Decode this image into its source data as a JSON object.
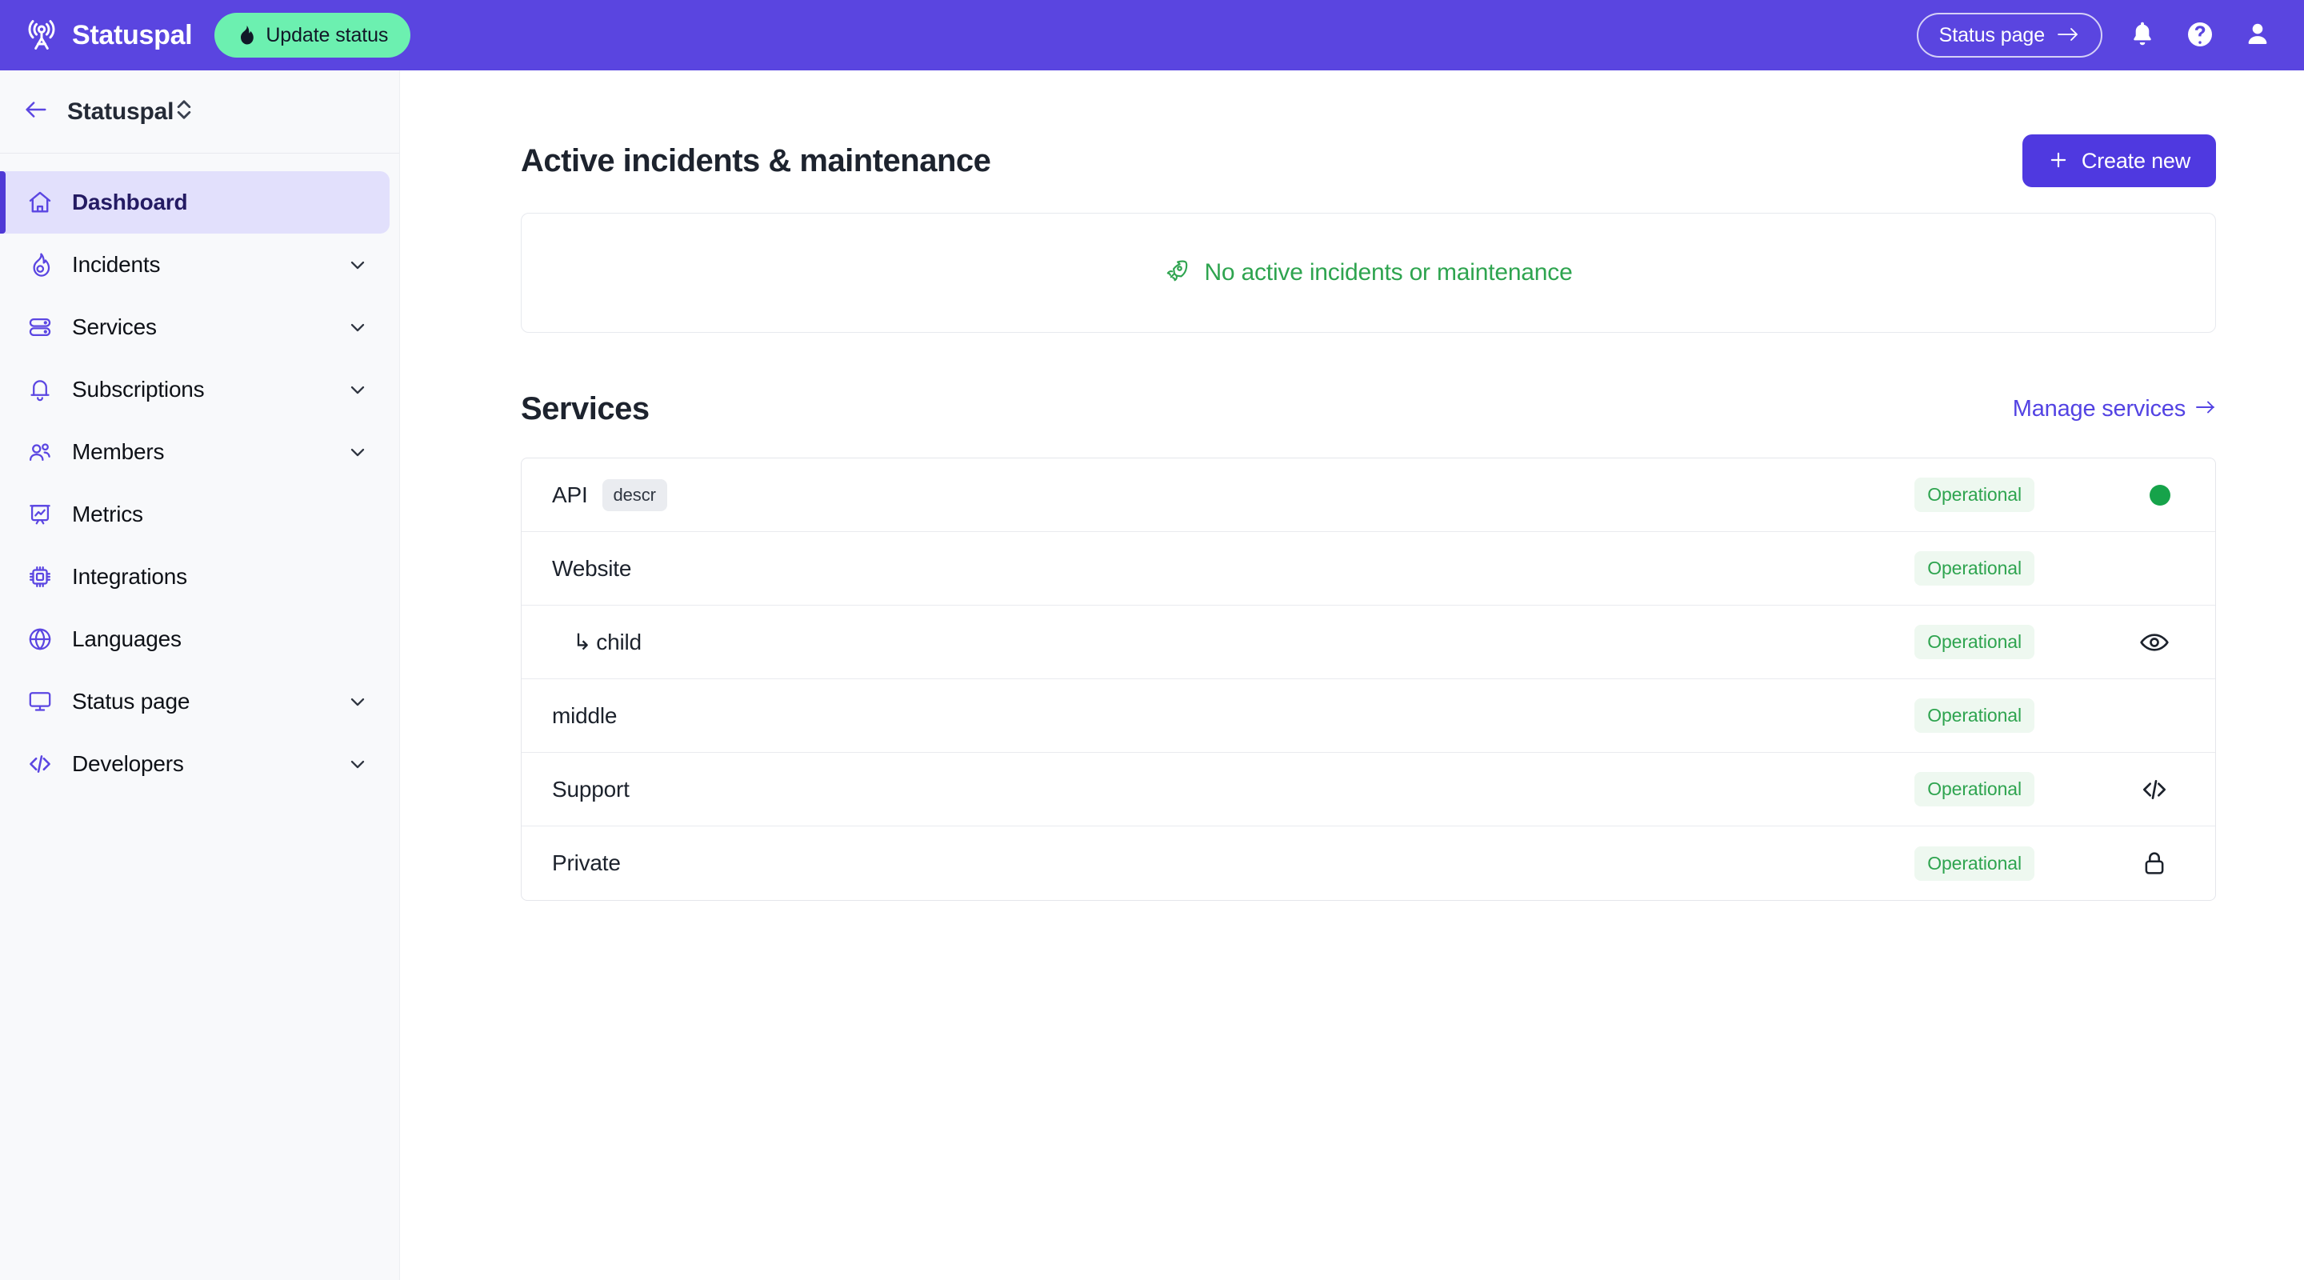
{
  "topbar": {
    "logo_icon": "broadcast-tower-icon",
    "brand": "Statuspal",
    "update_status": {
      "label": "Update status",
      "icon": "flame-icon"
    },
    "status_page": {
      "label": "Status page",
      "icon": "arrow-right-icon"
    },
    "notifications_icon": "bell-icon",
    "help_icon": "question-circle-icon",
    "account_icon": "user-avatar-icon",
    "brand_color": "#5a45e0",
    "accent_green": "#6cf0b0"
  },
  "sidebar": {
    "back_icon": "arrow-left-icon",
    "workspace": "Statuspal",
    "sort_icon": "chevron-up-down-icon",
    "items": [
      {
        "label": "Dashboard",
        "icon": "home-icon",
        "active": true,
        "expandable": false
      },
      {
        "label": "Incidents",
        "icon": "flame-icon",
        "active": false,
        "expandable": true
      },
      {
        "label": "Services",
        "icon": "server-icon",
        "active": false,
        "expandable": true
      },
      {
        "label": "Subscriptions",
        "icon": "bell-icon",
        "active": false,
        "expandable": true
      },
      {
        "label": "Members",
        "icon": "users-icon",
        "active": false,
        "expandable": true
      },
      {
        "label": "Metrics",
        "icon": "chart-icon",
        "active": false,
        "expandable": false
      },
      {
        "label": "Integrations",
        "icon": "chip-icon",
        "active": false,
        "expandable": false
      },
      {
        "label": "Languages",
        "icon": "globe-icon",
        "active": false,
        "expandable": false
      },
      {
        "label": "Status page",
        "icon": "monitor-icon",
        "active": false,
        "expandable": true
      },
      {
        "label": "Developers",
        "icon": "code-icon",
        "active": false,
        "expandable": true
      }
    ]
  },
  "main": {
    "incidents_section": {
      "title": "Active incidents & maintenance",
      "create_button": {
        "label": "Create new",
        "icon": "plus-icon"
      },
      "empty_state": {
        "text": "No active incidents or maintenance",
        "icon": "rocket-icon",
        "color": "#2ea44f"
      }
    },
    "services_section": {
      "title": "Services",
      "manage_link": {
        "label": "Manage services",
        "icon": "arrow-right-icon"
      },
      "rows": [
        {
          "name": "API",
          "child": false,
          "chip": "descr",
          "status": "Operational",
          "tail_icon": "green-dot-icon"
        },
        {
          "name": "Website",
          "child": false,
          "chip": null,
          "status": "Operational",
          "tail_icon": null
        },
        {
          "name": "child",
          "child": true,
          "chip": null,
          "status": "Operational",
          "tail_icon": "eye-icon"
        },
        {
          "name": "middle",
          "child": false,
          "chip": null,
          "status": "Operational",
          "tail_icon": null
        },
        {
          "name": "Support",
          "child": false,
          "chip": null,
          "status": "Operational",
          "tail_icon": "code-icon"
        },
        {
          "name": "Private",
          "child": false,
          "chip": null,
          "status": "Operational",
          "tail_icon": "lock-icon"
        }
      ],
      "child_prefix": "↳"
    }
  }
}
